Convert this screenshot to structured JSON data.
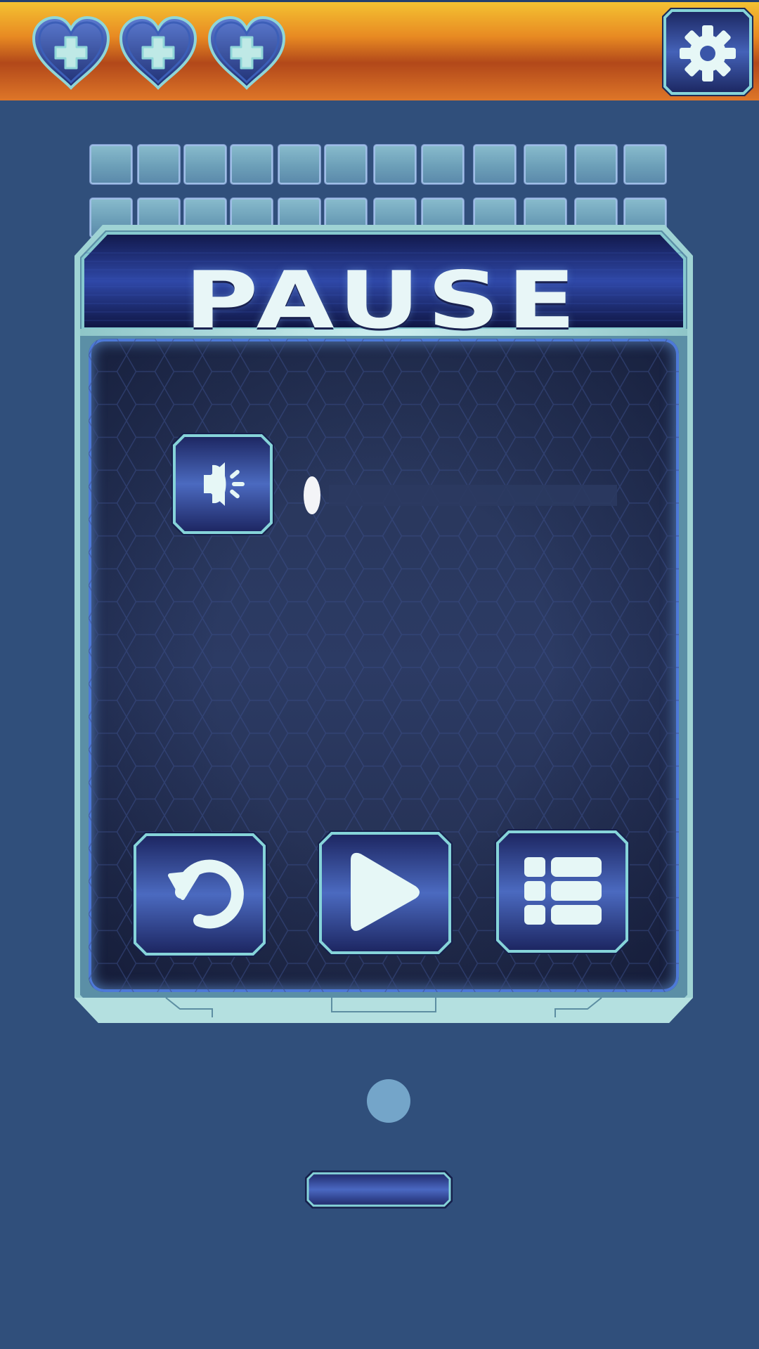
{
  "hud": {
    "lives": [
      {
        "name": "heart-icon",
        "state": "full"
      },
      {
        "name": "heart-icon",
        "state": "full"
      },
      {
        "name": "heart-icon",
        "state": "full"
      }
    ],
    "settings_icon": "gear-icon"
  },
  "bricks": {
    "rows": 2,
    "columns": 12,
    "color": "#7aaec3"
  },
  "pause_panel": {
    "title": "PAUSE",
    "sound_icon": "speaker-icon",
    "volume": 0.0,
    "buttons": [
      {
        "name": "restart-button",
        "icon": "restart-icon"
      },
      {
        "name": "resume-button",
        "icon": "play-icon"
      },
      {
        "name": "menu-button",
        "icon": "list-icon"
      }
    ]
  },
  "colors": {
    "background": "#304f7b",
    "topbar_gradient_top": "#f4c232",
    "topbar_gradient_mid": "#b2481a",
    "button_fill": "#3a4f9c",
    "button_border": "#7fd3d6",
    "icon_fill": "#e6f7f6",
    "ball": "#74a5c9"
  }
}
